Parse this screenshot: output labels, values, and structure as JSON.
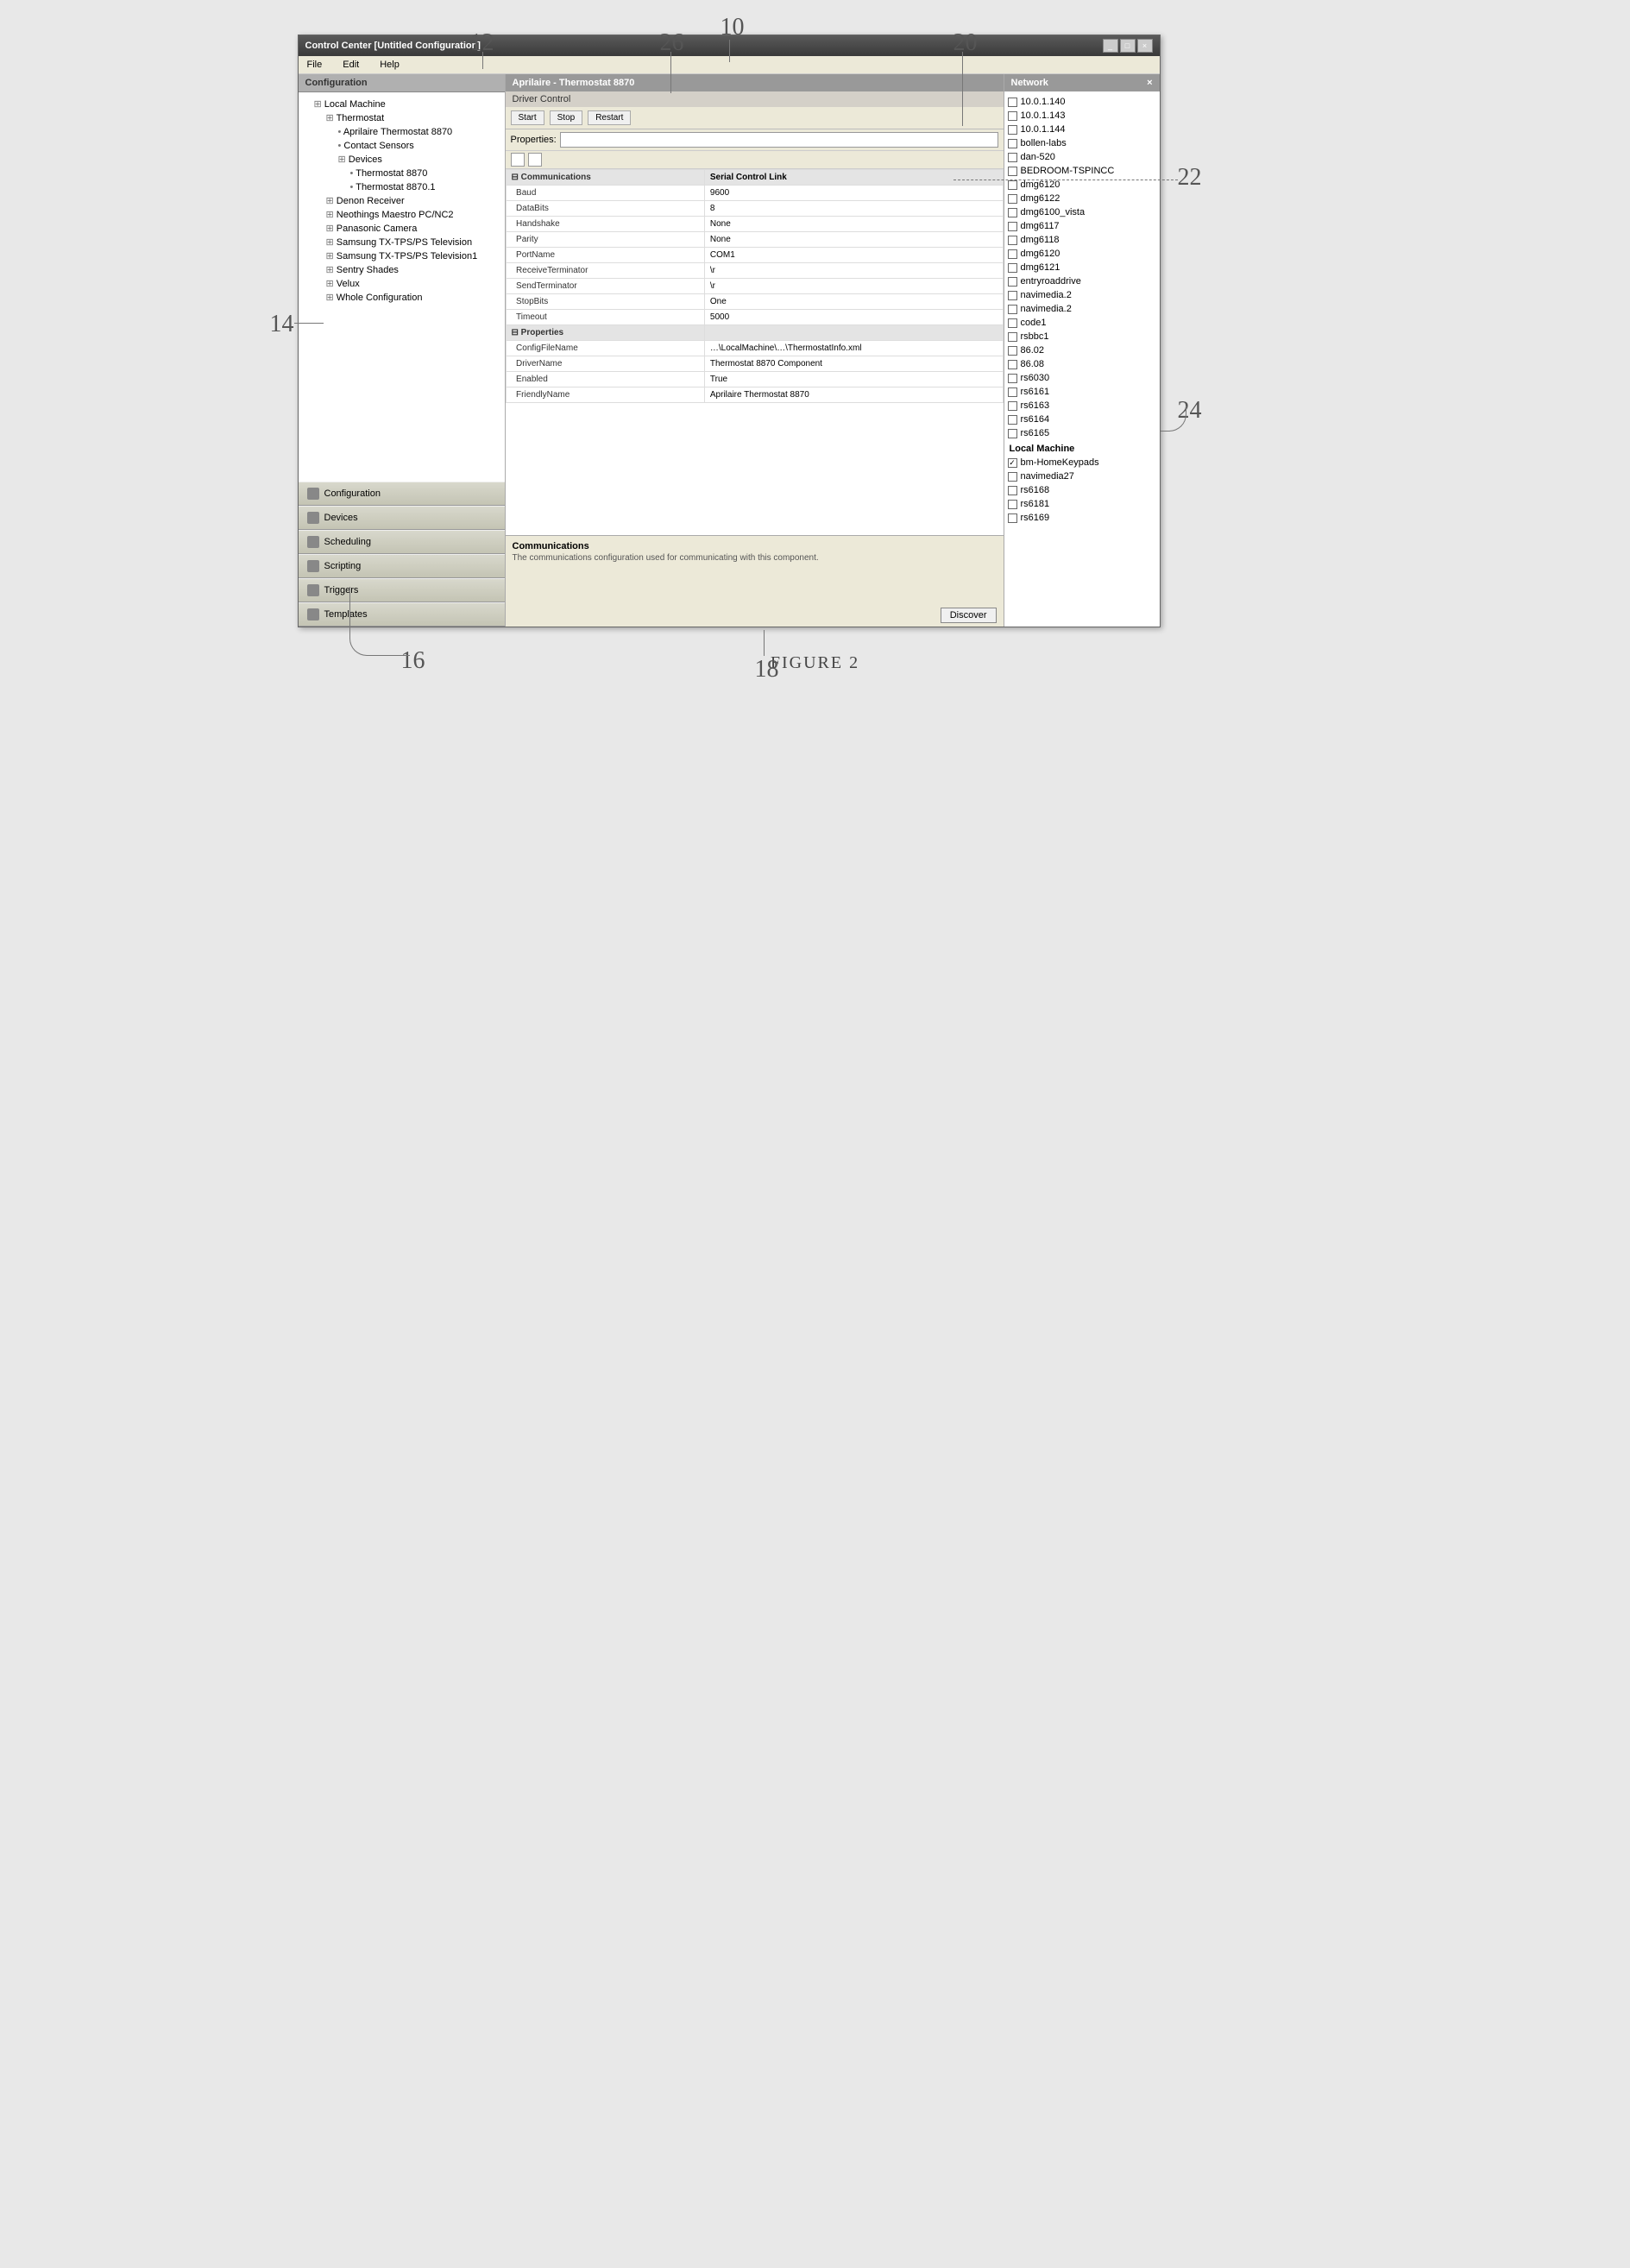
{
  "window": {
    "title": "Control Center [Untitled Configuration]",
    "menus": [
      "File",
      "Edit",
      "Help"
    ]
  },
  "sidebar": {
    "header": "Configuration",
    "tree": [
      {
        "label": "Local Machine",
        "cls": "node",
        "children": [
          {
            "label": "Thermostat",
            "cls": "node",
            "children": [
              {
                "label": "Aprilaire Thermostat 8870",
                "cls": "leaf"
              },
              {
                "label": "Contact Sensors",
                "cls": "leaf"
              },
              {
                "label": "Devices",
                "cls": "node",
                "children": [
                  {
                    "label": "Thermostat 8870",
                    "cls": "leaf"
                  },
                  {
                    "label": "Thermostat 8870.1",
                    "cls": "leaf"
                  }
                ]
              }
            ]
          },
          {
            "label": "Denon Receiver",
            "cls": "node"
          },
          {
            "label": "Neothings Maestro PC/NC2",
            "cls": "node"
          },
          {
            "label": "Panasonic Camera",
            "cls": "node"
          },
          {
            "label": "Samsung TX-TPS/PS Television",
            "cls": "node"
          },
          {
            "label": "Samsung TX-TPS/PS Television1",
            "cls": "node"
          },
          {
            "label": "Sentry Shades",
            "cls": "node"
          },
          {
            "label": "Velux",
            "cls": "node"
          },
          {
            "label": "Whole Configuration",
            "cls": "node"
          }
        ]
      }
    ],
    "nav": [
      {
        "id": "configuration",
        "label": "Configuration"
      },
      {
        "id": "devices",
        "label": "Devices"
      },
      {
        "id": "scheduling",
        "label": "Scheduling"
      },
      {
        "id": "scripting",
        "label": "Scripting"
      },
      {
        "id": "triggers",
        "label": "Triggers"
      },
      {
        "id": "templates",
        "label": "Templates"
      }
    ]
  },
  "center": {
    "header": "Aprilaire - Thermostat 8870",
    "subheader": "Driver Control",
    "toolbar": {
      "start": "Start",
      "stop": "Stop",
      "restart": "Restart"
    },
    "propbar": {
      "label": "Properties:",
      "value": ""
    },
    "groups": [
      {
        "name": "Communications",
        "type": "Serial Control Link",
        "rows": [
          {
            "k": "Baud",
            "v": "9600"
          },
          {
            "k": "DataBits",
            "v": "8"
          },
          {
            "k": "Handshake",
            "v": "None"
          },
          {
            "k": "Parity",
            "v": "None"
          },
          {
            "k": "PortName",
            "v": "COM1"
          },
          {
            "k": "ReceiveTerminator",
            "v": "\\r"
          },
          {
            "k": "SendTerminator",
            "v": "\\r"
          },
          {
            "k": "StopBits",
            "v": "One"
          },
          {
            "k": "Timeout",
            "v": "5000"
          }
        ]
      },
      {
        "name": "Properties",
        "rows": [
          {
            "k": "ConfigFileName",
            "v": "…\\LocalMachine\\…\\ThermostatInfo.xml"
          },
          {
            "k": "DriverName",
            "v": "Thermostat 8870 Component"
          },
          {
            "k": "Enabled",
            "v": "True"
          },
          {
            "k": "FriendlyName",
            "v": "Aprilaire Thermostat 8870"
          }
        ]
      }
    ],
    "help": {
      "title": "Communications",
      "desc": "The communications configuration used for communicating with this component."
    },
    "discoverBtn": "Discover"
  },
  "right": {
    "header": "Network",
    "items": [
      {
        "label": "10.0.1.140",
        "on": false
      },
      {
        "label": "10.0.1.143",
        "on": false
      },
      {
        "label": "10.0.1.144",
        "on": false
      },
      {
        "label": "bollen-labs",
        "on": false
      },
      {
        "label": "dan-520",
        "on": false
      },
      {
        "label": "BEDROOM-TSPINCC",
        "on": false
      },
      {
        "label": "dmg6120",
        "on": false
      },
      {
        "label": "dmg6122",
        "on": false
      },
      {
        "label": "dmg6100_vista",
        "on": false
      },
      {
        "label": "dmg6117",
        "on": false
      },
      {
        "label": "dmg6118",
        "on": false
      },
      {
        "label": "dmg6120",
        "on": false
      },
      {
        "label": "dmg6121",
        "on": false
      },
      {
        "label": "entryroaddrive",
        "on": false
      },
      {
        "label": "navimedia.2",
        "on": false
      },
      {
        "label": "navimedia.2",
        "on": false
      },
      {
        "label": "code1",
        "on": false
      },
      {
        "label": "rsbbc1",
        "on": false
      },
      {
        "label": "86.02",
        "on": false
      },
      {
        "label": "86.08",
        "on": false
      },
      {
        "label": "rs6030",
        "on": false
      },
      {
        "label": "rs6161",
        "on": false
      },
      {
        "label": "rs6163",
        "on": false
      },
      {
        "label": "rs6164",
        "on": false
      },
      {
        "label": "rs6165",
        "on": false
      }
    ],
    "groupLabel": "Local Machine",
    "groupItems": [
      {
        "label": "bm-HomeKeypads",
        "on": true
      },
      {
        "label": "navimedia27",
        "on": false
      },
      {
        "label": "rs6168",
        "on": false
      },
      {
        "label": "rs6181",
        "on": false
      },
      {
        "label": "rs6169",
        "on": false
      }
    ]
  },
  "callouts": {
    "c10": "10",
    "c12": "12",
    "c14": "14",
    "c16": "16",
    "c18": "18",
    "c20": "20",
    "c22": "22",
    "c24": "24",
    "c26": "26",
    "caption": "FIGURE 2"
  }
}
